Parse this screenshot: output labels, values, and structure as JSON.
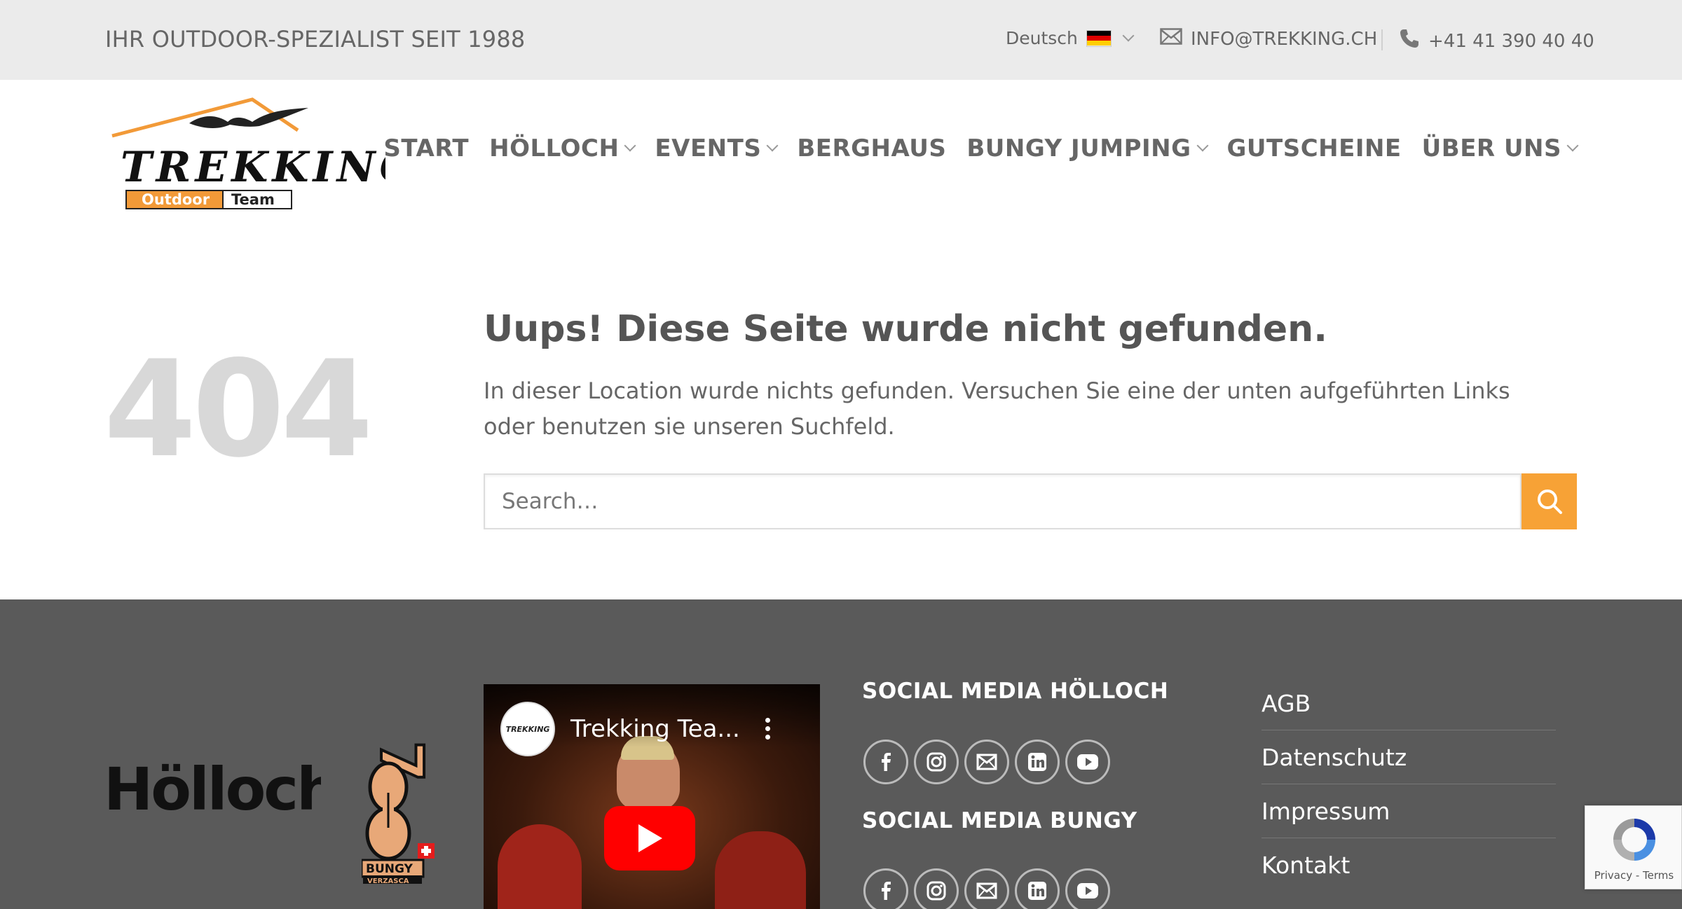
{
  "topbar": {
    "tagline": "IHR OUTDOOR-SPEZIALIST SEIT 1988",
    "language": "Deutsch",
    "email": "INFO@TREKKING.CH",
    "phone": "+41 41 390 40 40"
  },
  "logo": {
    "word": "TREKKING",
    "sub_left": "Outdoor",
    "sub_right": "Team"
  },
  "nav": {
    "items": [
      {
        "label": "START"
      },
      {
        "label": "HÖLLOCH"
      },
      {
        "label": "EVENTS"
      },
      {
        "label": "BERGHAUS"
      },
      {
        "label": "BUNGY JUMPING"
      },
      {
        "label": "GUTSCHEINE"
      },
      {
        "label": "ÜBER UNS"
      }
    ]
  },
  "error": {
    "code": "404",
    "title": "Uups! Diese Seite wurde nicht gefunden.",
    "text": "In dieser Location wurde nichts gefunden. Versuchen Sie eine der unten aufgeführten Links oder benutzen sie unseren Suchfeld.",
    "search_placeholder": "Search…"
  },
  "footer": {
    "holloch_logo": "Hölloch",
    "bungy_logo": "BUNGY",
    "bungy_sub": "VERZASCA",
    "bungy_number": "7",
    "video": {
      "title": "Trekking Tea...",
      "channel": "TREKKING"
    },
    "social_holloch_heading": "SOCIAL MEDIA HÖLLOCH",
    "social_bungy_heading": "SOCIAL MEDIA BUNGY",
    "social_icons": [
      "facebook-icon",
      "instagram-icon",
      "email-icon",
      "linkedin-icon",
      "youtube-icon"
    ],
    "links": [
      {
        "label": "AGB"
      },
      {
        "label": "Datenschutz"
      },
      {
        "label": "Impressum"
      },
      {
        "label": "Kontakt"
      }
    ]
  },
  "recaptcha": {
    "privacy": "Privacy",
    "separator": " - ",
    "terms": "Terms"
  },
  "colors": {
    "accent": "#f7a236",
    "topbar_bg": "#ebebeb",
    "footer_bg": "#5a5a5a",
    "text": "#666666"
  }
}
